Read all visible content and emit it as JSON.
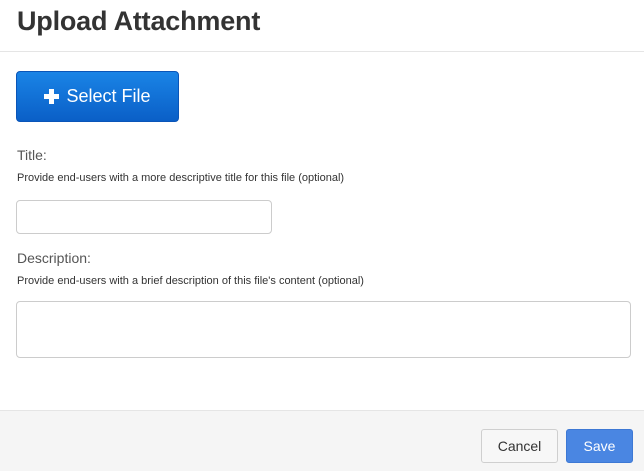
{
  "dialog": {
    "title": "Upload Attachment"
  },
  "upload": {
    "select_file_label": "Select File",
    "icon": "plus-icon"
  },
  "fields": {
    "title": {
      "label": "Title:",
      "help": "Provide end-users with a more descriptive title for this file (optional)",
      "value": "",
      "placeholder": ""
    },
    "description": {
      "label": "Description:",
      "help": "Provide end-users with a brief description of this file's content (optional)",
      "value": "",
      "placeholder": ""
    }
  },
  "footer": {
    "cancel_label": "Cancel",
    "save_label": "Save"
  },
  "colors": {
    "primary_button": "#0a5fc7",
    "save_button": "#4a86e2",
    "footer_background": "#f5f5f5"
  }
}
